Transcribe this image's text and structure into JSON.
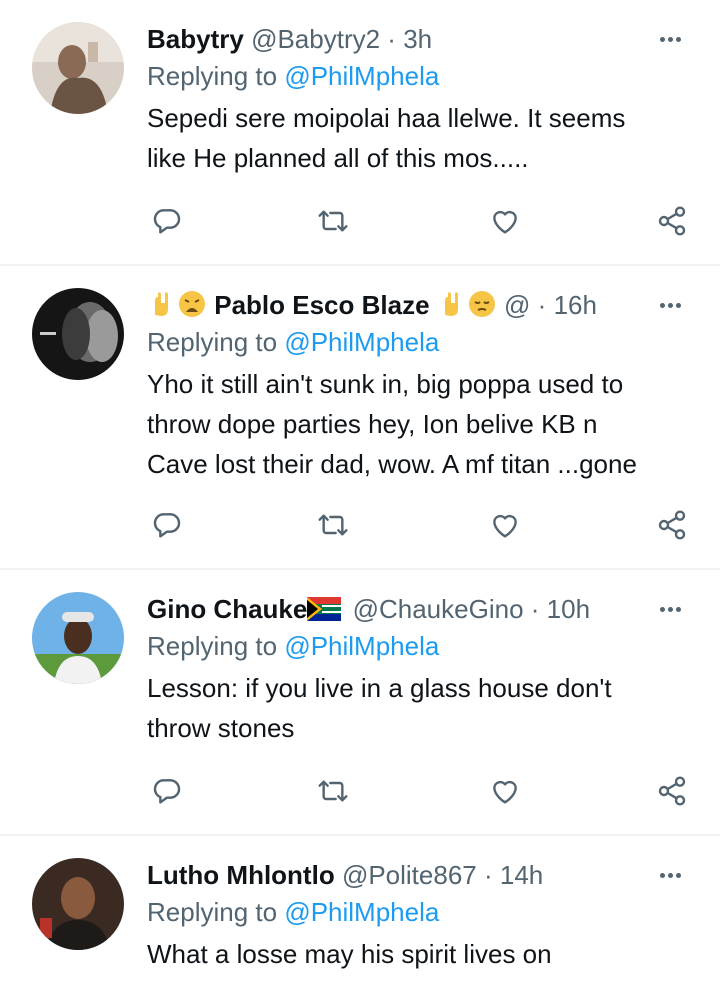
{
  "reply_prefix": "Replying to",
  "tweets": [
    {
      "name": "Babytry",
      "handle": "@Babytry2",
      "dot": "·",
      "time": "3h",
      "replying_to": "@PhilMphela",
      "text_lines": [
        "Sepedi sere moipolai haa llelwe. It seems",
        "like He planned all of this mos....."
      ]
    },
    {
      "name": "Pablo Esco Blaze",
      "name_prefix_emojis": [
        "sign-of-horns",
        "weary-face"
      ],
      "name_suffix_emojis": [
        "sign-of-horns",
        "pensive-face"
      ],
      "handle": "@",
      "dot": "·",
      "time": "16h",
      "replying_to": "@PhilMphela",
      "text_lines": [
        "Yho it still ain't sunk in, big poppa used to",
        "throw dope parties hey, Ion belive KB n",
        "Cave lost their dad, wow. A mf titan ...gone"
      ]
    },
    {
      "name": "Gino Chauke",
      "name_suffix_emojis": [
        "south-africa-flag"
      ],
      "handle": "@ChaukeGino",
      "dot": "·",
      "time": "10h",
      "replying_to": "@PhilMphela",
      "text_lines": [
        "Lesson: if you live in a glass house don't",
        "throw stones"
      ]
    },
    {
      "name": "Lutho Mhlontlo",
      "handle": "@Polite867",
      "dot": "·",
      "time": "14h",
      "replying_to": "@PhilMphela",
      "text_lines": [
        "What a losse may his spirit lives on"
      ]
    }
  ],
  "icons": {
    "reply": "reply-icon",
    "retweet": "retweet-icon",
    "like": "like-icon",
    "share": "share-icon",
    "more": "more-icon"
  },
  "colors": {
    "text": "#0f1419",
    "secondary": "#536471",
    "link": "#1d9bf0",
    "divider": "#eff3f4"
  }
}
